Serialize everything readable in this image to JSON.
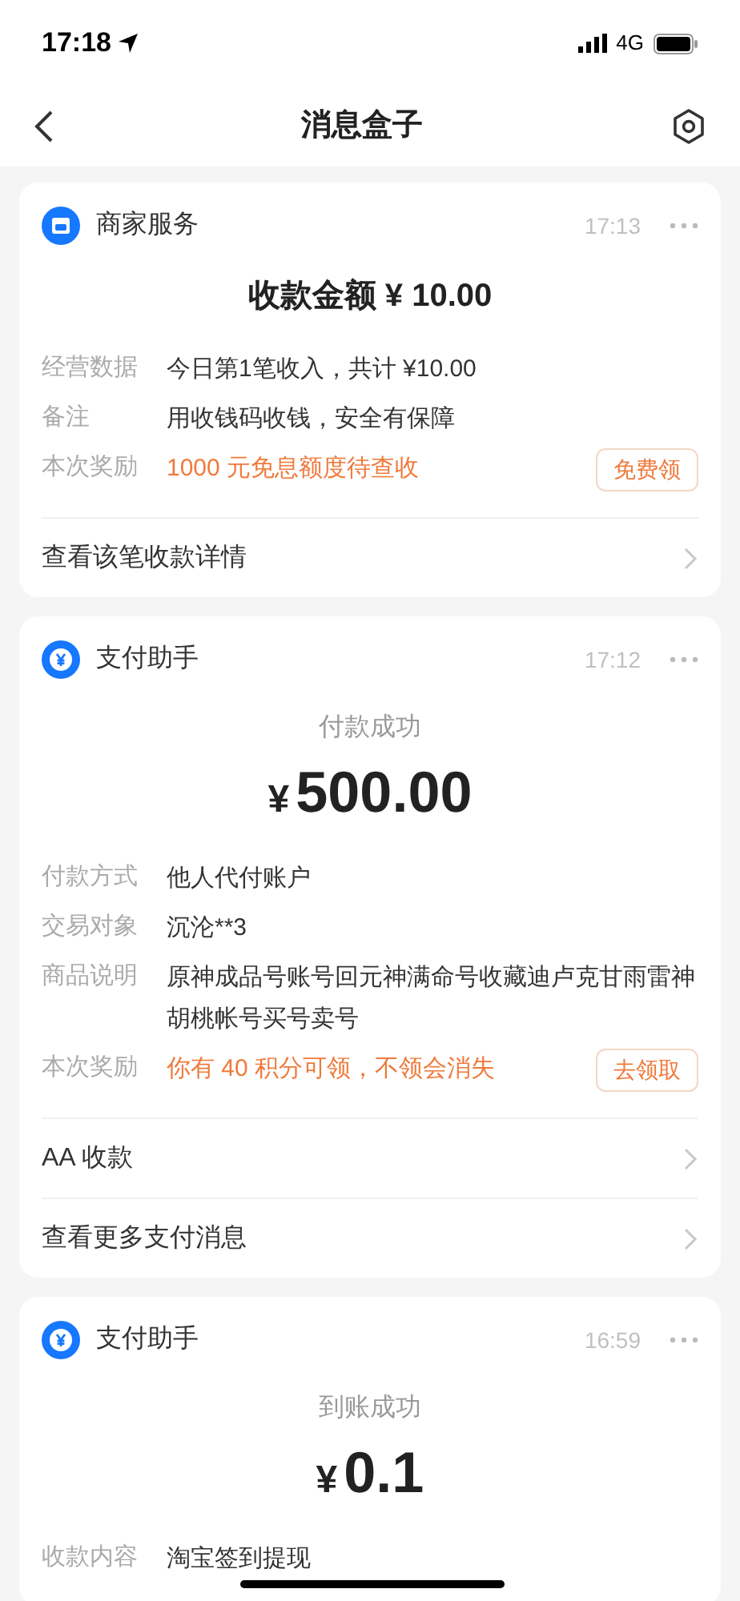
{
  "status_bar": {
    "time": "17:18",
    "network": "4G"
  },
  "nav": {
    "title": "消息盒子"
  },
  "cards": [
    {
      "kind": "merchant",
      "source": "商家服务",
      "time": "17:13",
      "headline": "收款金额 ¥ 10.00",
      "details": [
        {
          "label": "经营数据",
          "value": "今日第1笔收入，共计 ¥10.00",
          "kind": "normal"
        },
        {
          "label": "备注",
          "value": "用收钱码收钱，安全有保障",
          "kind": "normal"
        },
        {
          "label": "本次奖励",
          "value": "1000 元免息额度待查收",
          "kind": "reward",
          "button": "免费领"
        }
      ],
      "links": [
        "查看该笔收款详情"
      ]
    },
    {
      "kind": "payment",
      "source": "支付助手",
      "time": "17:12",
      "status": "付款成功",
      "currency": "¥",
      "amount": "500.00",
      "details": [
        {
          "label": "付款方式",
          "value": "他人代付账户",
          "kind": "normal"
        },
        {
          "label": "交易对象",
          "value": "沉沦**3",
          "kind": "normal"
        },
        {
          "label": "商品说明",
          "value": "原神成品号账号回元神满命号收藏迪卢克甘雨雷神胡桃帐号买号卖号",
          "kind": "normal"
        },
        {
          "label": "本次奖励",
          "value": "你有 40 积分可领，不领会消失",
          "kind": "reward",
          "button": "去领取"
        }
      ],
      "links": [
        "AA 收款",
        "查看更多支付消息"
      ]
    },
    {
      "kind": "payment",
      "source": "支付助手",
      "time": "16:59",
      "status": "到账成功",
      "currency": "¥",
      "amount": "0.1",
      "details": [
        {
          "label": "收款内容",
          "value": "淘宝签到提现",
          "kind": "normal"
        }
      ]
    }
  ]
}
